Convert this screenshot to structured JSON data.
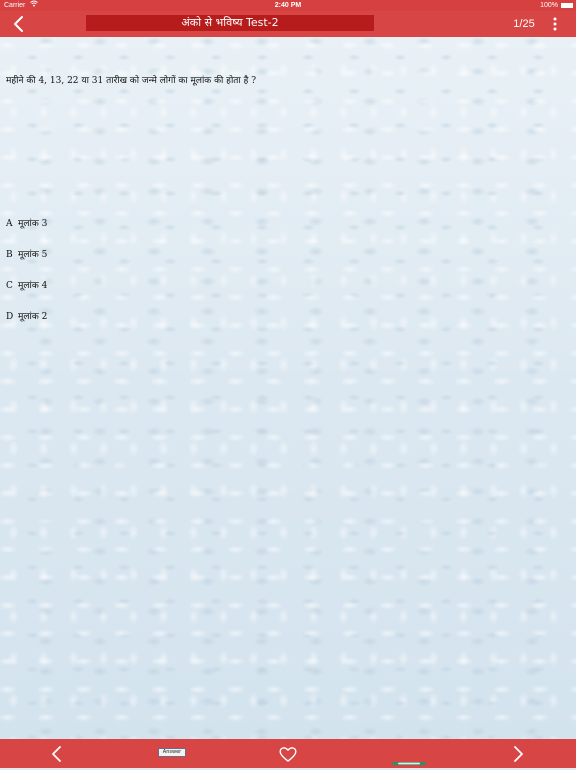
{
  "status_bar": {
    "carrier": "Carrier",
    "time": "2:40 PM",
    "battery": "100%"
  },
  "nav": {
    "title": "अंको से भविष्य Test-2",
    "counter": "1/25"
  },
  "question": {
    "text": "महीने की 4, 13, 22 या 31 तारीख को जन्मे लोगों का मूलांक की होता है ?"
  },
  "options": [
    {
      "letter": "A",
      "text": "मूलांक 3"
    },
    {
      "letter": "B",
      "text": "मूलांक 5"
    },
    {
      "letter": "C",
      "text": "मूलांक 4"
    },
    {
      "letter": "D",
      "text": "मूलांक 2"
    }
  ],
  "toolbar": {
    "answer_label": "Answer"
  },
  "icons": {
    "back": "chevron-left-icon",
    "more": "more-vertical-icon",
    "prev": "chevron-left-icon",
    "favorite": "heart-icon",
    "slider": "slider-icon",
    "next": "chevron-right-icon"
  },
  "colors": {
    "bar": "#d84545",
    "title_box": "#b71c1c",
    "background": "#e3edf4"
  }
}
